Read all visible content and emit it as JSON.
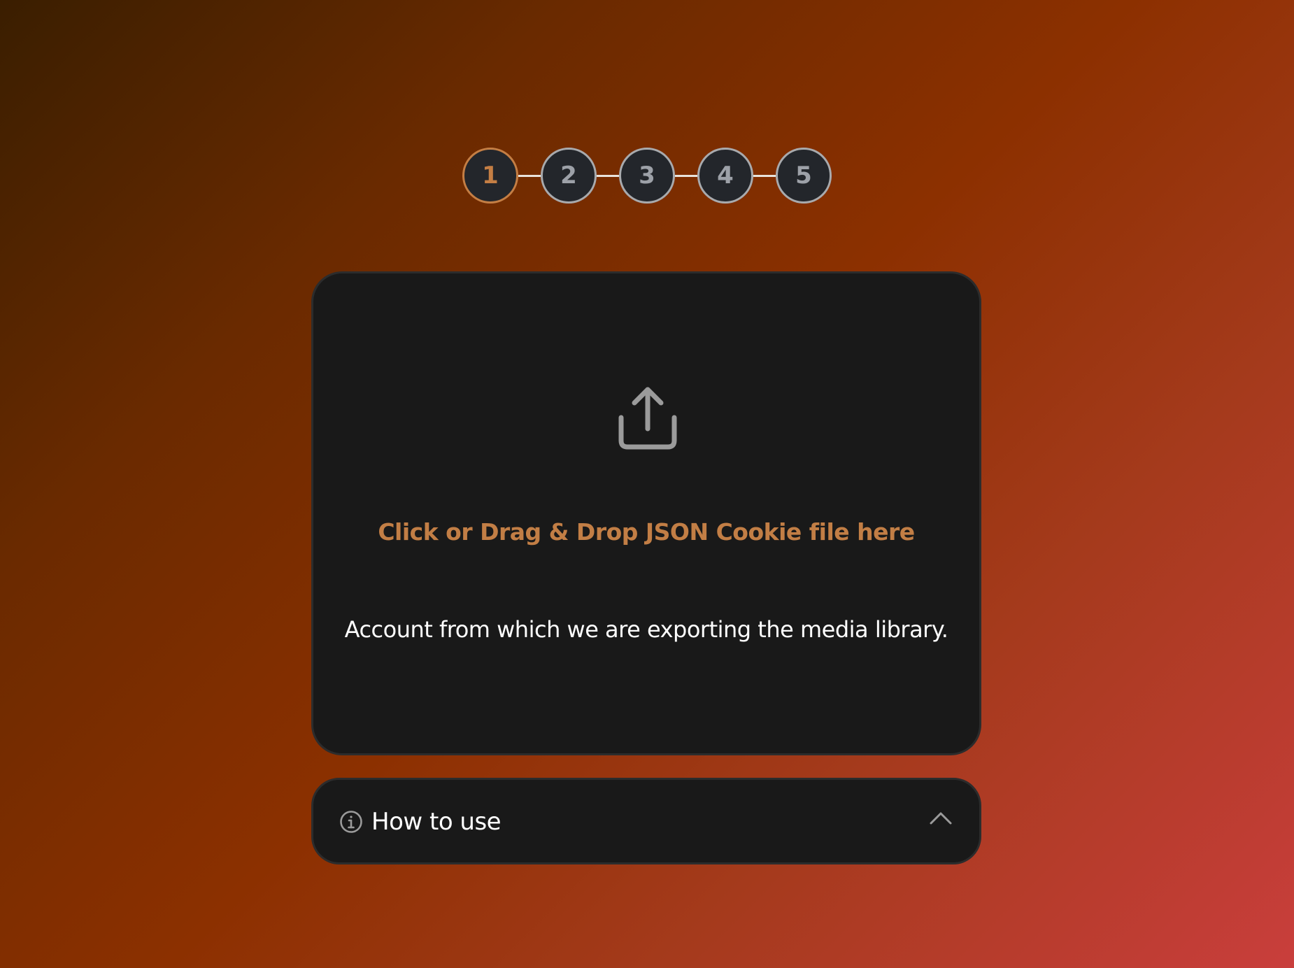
{
  "stepper": {
    "steps": [
      {
        "label": "1",
        "active": true
      },
      {
        "label": "2",
        "active": false
      },
      {
        "label": "3",
        "active": false
      },
      {
        "label": "4",
        "active": false
      },
      {
        "label": "5",
        "active": false
      }
    ]
  },
  "upload": {
    "icon": "upload-icon",
    "title": "Click or Drag & Drop JSON Cookie file here",
    "description": "Account from which we are exporting the media library."
  },
  "accordion": {
    "icon": "info-icon",
    "label": "How to use",
    "toggle_icon": "chevron-up-icon",
    "expanded": false
  },
  "colors": {
    "accent": "#c27e45",
    "card_background": "#191919",
    "step_inactive": "#a8aaad"
  }
}
